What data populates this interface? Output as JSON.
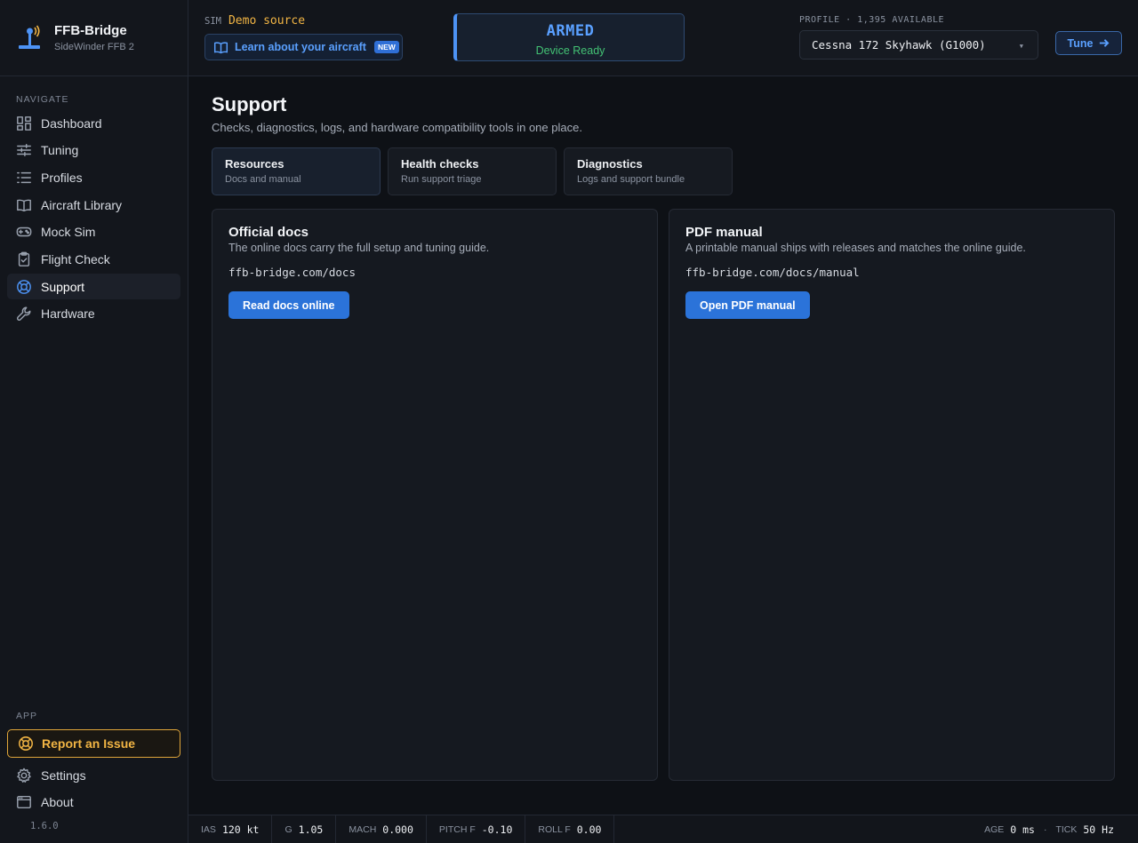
{
  "brand": {
    "title": "FFB-Bridge",
    "subtitle": "SideWinder FFB 2"
  },
  "sidebar": {
    "navigate_label": "NAVIGATE",
    "items": [
      {
        "label": "Dashboard",
        "icon": "dashboard-icon"
      },
      {
        "label": "Tuning",
        "icon": "sliders-icon"
      },
      {
        "label": "Profiles",
        "icon": "list-icon"
      },
      {
        "label": "Aircraft Library",
        "icon": "book-icon"
      },
      {
        "label": "Mock Sim",
        "icon": "gamepad-icon"
      },
      {
        "label": "Flight Check",
        "icon": "clipboard-check-icon"
      },
      {
        "label": "Support",
        "icon": "lifebuoy-icon",
        "active": true
      },
      {
        "label": "Hardware",
        "icon": "wrench-icon"
      }
    ],
    "app_label": "APP",
    "report_label": "Report an Issue",
    "app_items": [
      {
        "label": "Settings",
        "icon": "gear-icon"
      },
      {
        "label": "About",
        "icon": "window-icon"
      }
    ],
    "version": "1.6.0"
  },
  "header": {
    "sim_label": "SIM",
    "sim_value": "Demo source",
    "learn_label": "Learn about your aircraft",
    "new_badge": "NEW",
    "status_title": "ARMED",
    "status_sub": "Device Ready",
    "profile_label": "PROFILE · 1,395 AVAILABLE",
    "profile_value": "Cessna 172 Skyhawk (G1000)",
    "tune_label": "Tune"
  },
  "main": {
    "title": "Support",
    "subtitle": "Checks, diagnostics, logs, and hardware compatibility tools in one place.",
    "tabs": [
      {
        "title": "Resources",
        "sub": "Docs and manual"
      },
      {
        "title": "Health checks",
        "sub": "Run support triage"
      },
      {
        "title": "Diagnostics",
        "sub": "Logs and support bundle"
      }
    ],
    "cards": [
      {
        "title": "Official docs",
        "desc": "The online docs carry the full setup and tuning guide.",
        "url": "ffb-bridge.com/docs",
        "button": "Read docs online"
      },
      {
        "title": "PDF manual",
        "desc": "A printable manual ships with releases and matches the online guide.",
        "url": "ffb-bridge.com/docs/manual",
        "button": "Open PDF manual"
      }
    ]
  },
  "footer": {
    "stats": [
      {
        "label": "IAS",
        "value": "120 kt"
      },
      {
        "label": "G",
        "value": "1.05"
      },
      {
        "label": "MACH",
        "value": "0.000"
      },
      {
        "label": "PITCH F",
        "value": "-0.10"
      },
      {
        "label": "ROLL F",
        "value": "0.00"
      }
    ],
    "age_label": "AGE",
    "age_value": "0 ms",
    "tick_label": "TICK",
    "tick_value": "50 Hz"
  },
  "colors": {
    "accent": "#4d93f5",
    "warning": "#f2b544",
    "success": "#43c274",
    "background": "#0e1116"
  }
}
